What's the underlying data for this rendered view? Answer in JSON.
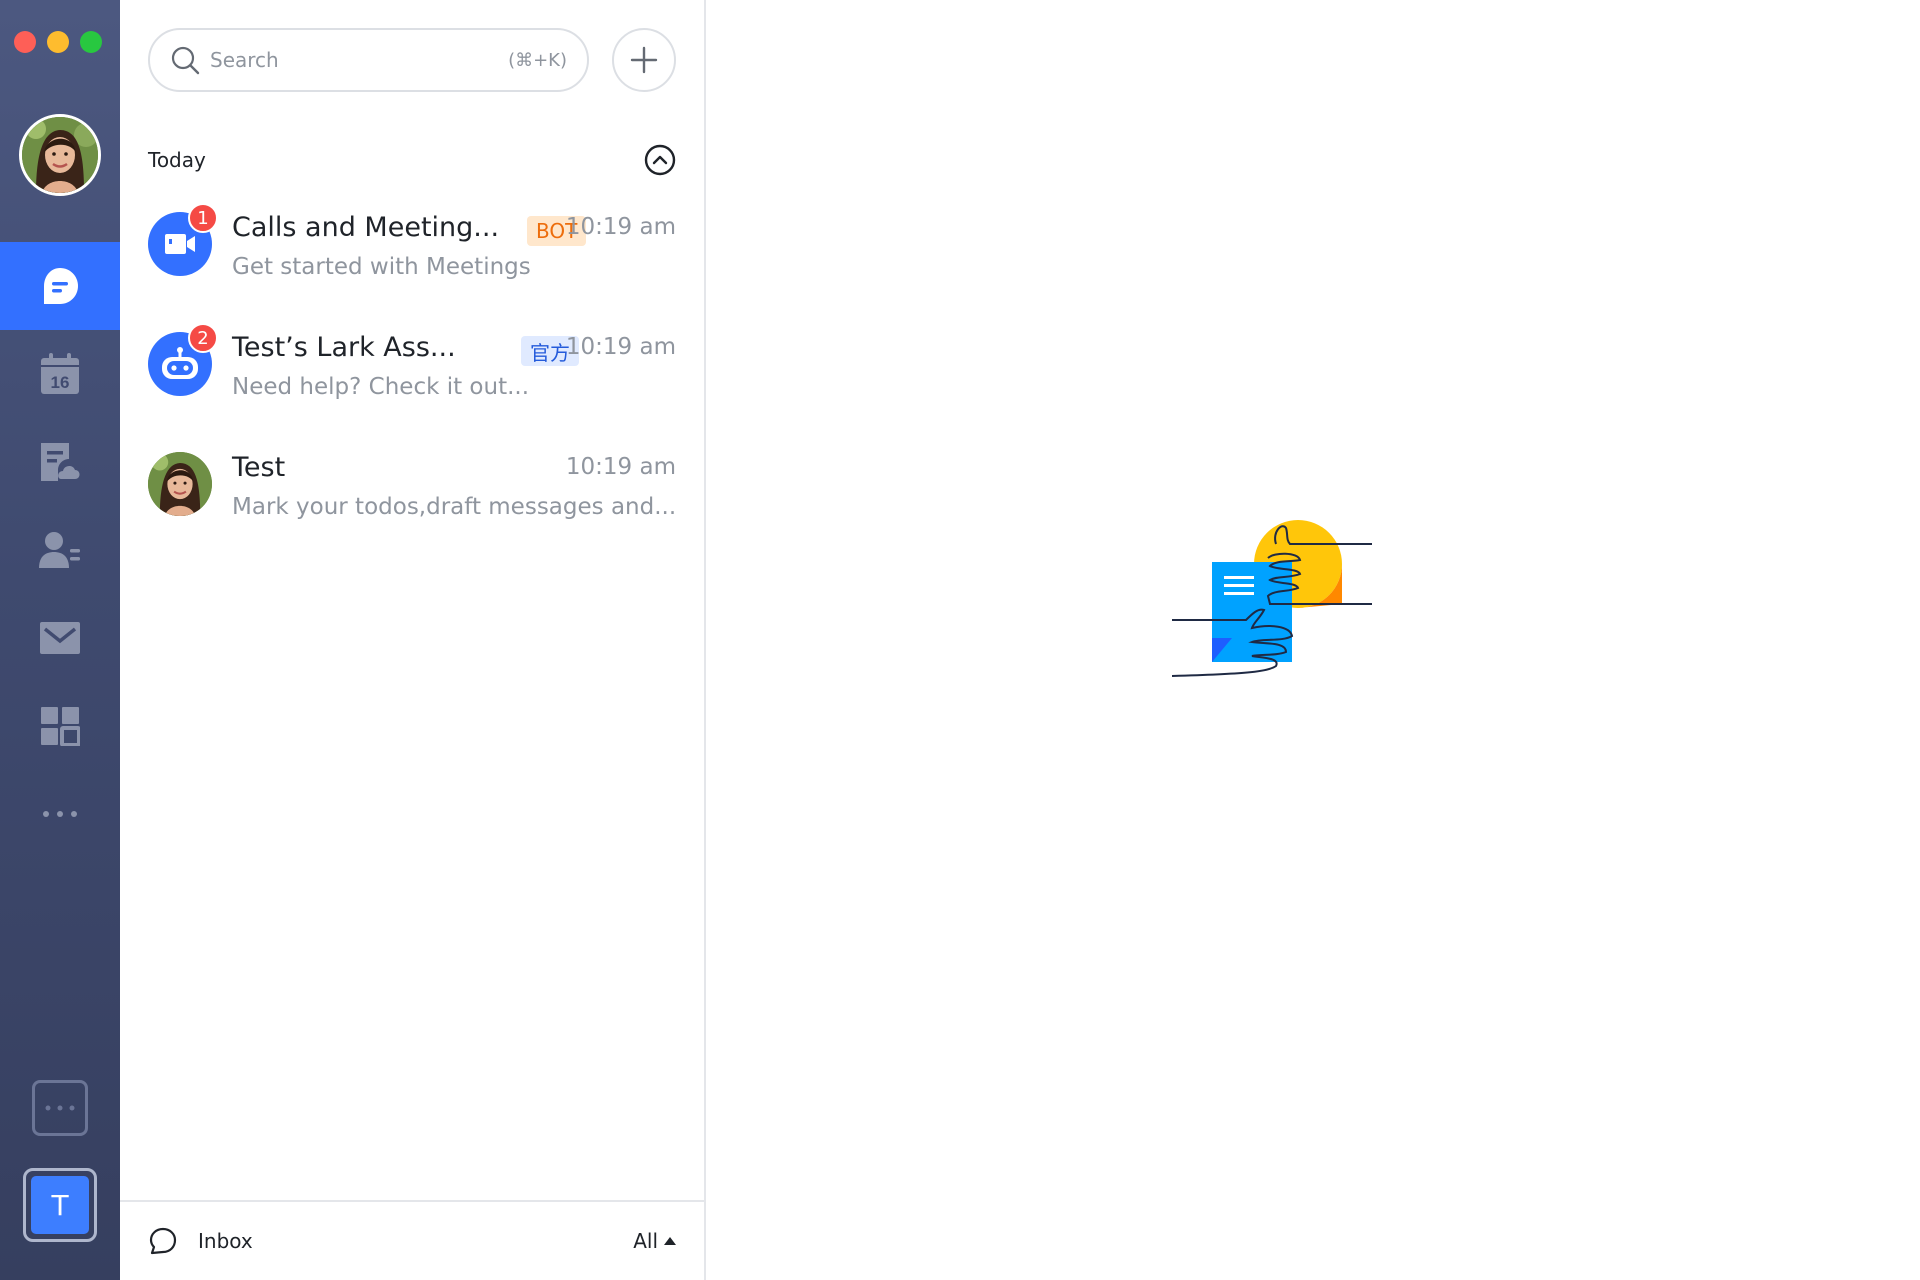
{
  "window": {
    "controls": [
      "close",
      "minimize",
      "maximize"
    ]
  },
  "colors": {
    "accent": "#3370ff",
    "badge": "#f54a45",
    "rail": "#414b70"
  },
  "rail": {
    "items": [
      {
        "icon": "chat-icon",
        "active": true
      },
      {
        "icon": "calendar-icon",
        "date": "16"
      },
      {
        "icon": "docs-icon"
      },
      {
        "icon": "contacts-icon"
      },
      {
        "icon": "mail-icon"
      },
      {
        "icon": "workplace-icon"
      },
      {
        "icon": "more-icon"
      }
    ],
    "tenant_initial": "T"
  },
  "search": {
    "placeholder": "Search",
    "shortcut": "(⌘+K)"
  },
  "section": {
    "title": "Today"
  },
  "chats": [
    {
      "name": "Calls and Meeting...",
      "tag": "BOT",
      "time": "10:19 am",
      "preview": "Get started with Meetings",
      "badge": "1",
      "avatar": "meetings-bot-icon"
    },
    {
      "name": "Test’s Lark Ass...",
      "tag": "官方",
      "time": "10:19 am",
      "preview": "Need help? Check it out...",
      "badge": "2",
      "avatar": "assistant-bot-icon"
    },
    {
      "name": "Test",
      "time": "10:19 am",
      "preview": "Mark your todos,draft messages and...",
      "avatar": "user-photo"
    }
  ],
  "footer": {
    "label": "Inbox",
    "filter": "All"
  }
}
